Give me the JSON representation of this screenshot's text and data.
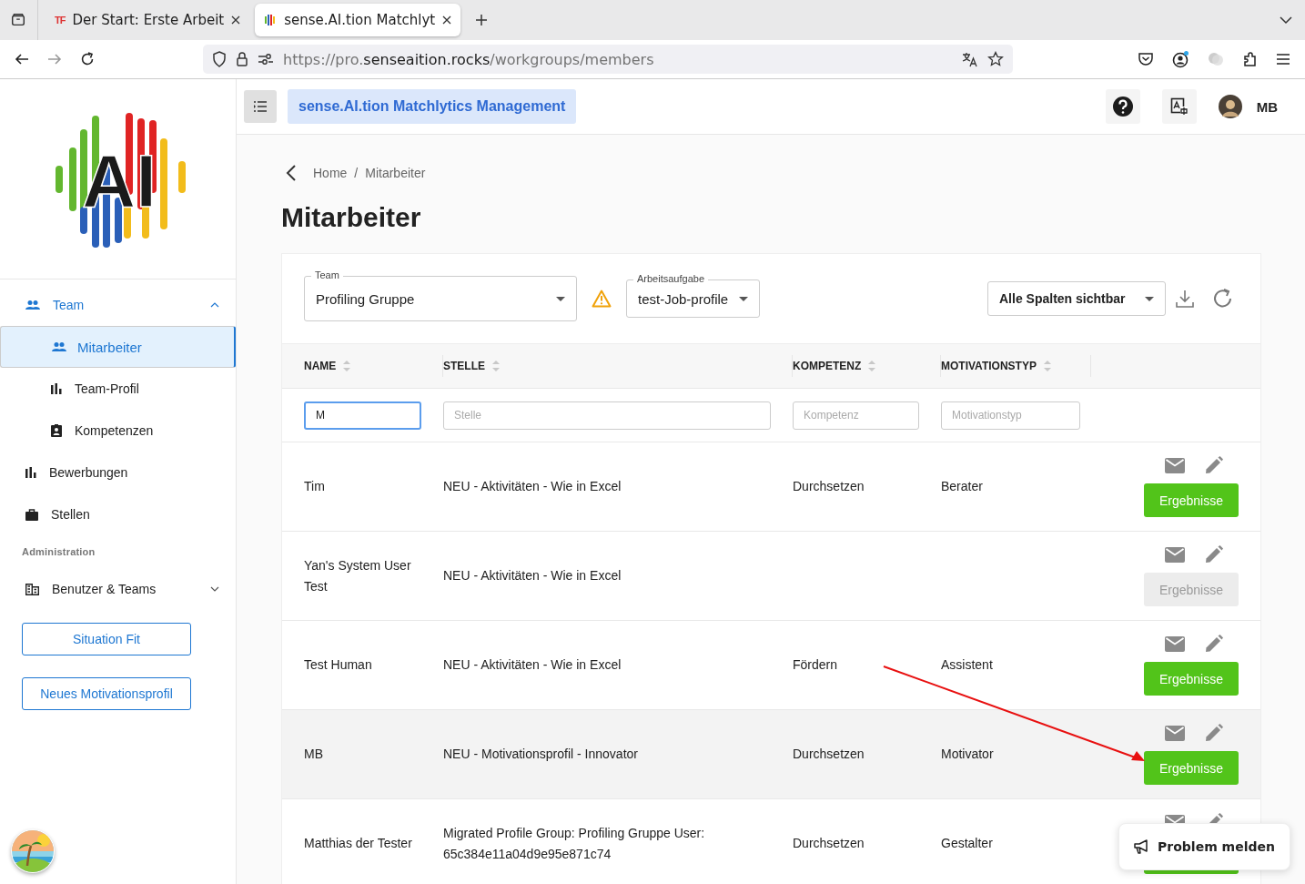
{
  "browser": {
    "tabs": [
      {
        "favicon": "TF",
        "title": "Der Start: Erste Arbeit",
        "selected": false
      },
      {
        "title": "sense.AI.tion Matchlyt",
        "selected": true
      }
    ],
    "url": {
      "scheme": "https://pro.",
      "domain": "senseaition.rocks",
      "path": "/workgroups/members"
    }
  },
  "header": {
    "title": "sense.AI.tion Matchlytics Management",
    "user": "MB"
  },
  "sidebar": {
    "logo": "AI",
    "items": [
      {
        "kind": "group",
        "label": "Team",
        "selected": false,
        "expanded": true,
        "children": [
          {
            "label": "Mitarbeiter",
            "selected": true
          },
          {
            "label": "Team-Profil",
            "selected": false
          },
          {
            "label": "Kompetenzen",
            "selected": false
          }
        ]
      },
      {
        "kind": "item",
        "label": "Bewerbungen",
        "selected": false
      },
      {
        "kind": "item",
        "label": "Stellen",
        "selected": false
      },
      {
        "kind": "section",
        "label": "Administration"
      },
      {
        "kind": "group",
        "label": "Benutzer & Teams",
        "selected": false,
        "expanded": false
      }
    ],
    "buttons": [
      "Situation Fit",
      "Neues Motivationsprofil"
    ]
  },
  "breadcrumb": {
    "items": [
      "Home",
      "Mitarbeiter"
    ],
    "separator": "/"
  },
  "page_title": "Mitarbeiter",
  "filters": {
    "team": {
      "label": "Team",
      "value": "Profiling Gruppe",
      "warning": true
    },
    "task": {
      "label": "Arbeitsaufgabe",
      "value": "test-Job-profile"
    },
    "columns": {
      "value": "Alle Spalten sichtbar"
    }
  },
  "table": {
    "columns": [
      {
        "label": "NAME",
        "filter_value": "M",
        "focused": true
      },
      {
        "label": "STELLE",
        "placeholder": "Stelle",
        "focused": false
      },
      {
        "label": "KOMPETENZ",
        "placeholder": "Kompetenz",
        "focused": false
      },
      {
        "label": "MOTIVATIONSTYP",
        "placeholder": "Motivationstyp",
        "focused": false
      }
    ],
    "rows": [
      {
        "name": "Tim",
        "stelle": "NEU - Aktivitäten - Wie in Excel",
        "kompetenz": "Durchsetzen",
        "motivationstyp": "Berater",
        "highlighted": false,
        "results": {
          "label": "Ergebnisse",
          "disabled": false
        }
      },
      {
        "name": "Yan's System User Test",
        "stelle": "NEU - Aktivitäten - Wie in Excel",
        "kompetenz": "",
        "motivationstyp": "",
        "highlighted": false,
        "results": {
          "label": "Ergebnisse",
          "disabled": true
        }
      },
      {
        "name": "Test Human",
        "stelle": "NEU - Aktivitäten - Wie in Excel",
        "kompetenz": "Fördern",
        "motivationstyp": "Assistent",
        "highlighted": false,
        "results": {
          "label": "Ergebnisse",
          "disabled": false
        }
      },
      {
        "name": "MB",
        "stelle": "NEU - Motivationsprofil - Innovator",
        "kompetenz": "Durchsetzen",
        "motivationstyp": "Motivator",
        "highlighted": true,
        "results": {
          "label": "Ergebnisse",
          "disabled": false
        }
      },
      {
        "name": "Matthias der Tester",
        "stelle": "Migrated Profile Group: Profiling Gruppe User: 65c384e11a04d9e95e871c74",
        "kompetenz": "Durchsetzen",
        "motivationstyp": "Gestalter",
        "highlighted": false,
        "results": {
          "disabled": false
        }
      }
    ]
  },
  "report_button": "Problem melden"
}
